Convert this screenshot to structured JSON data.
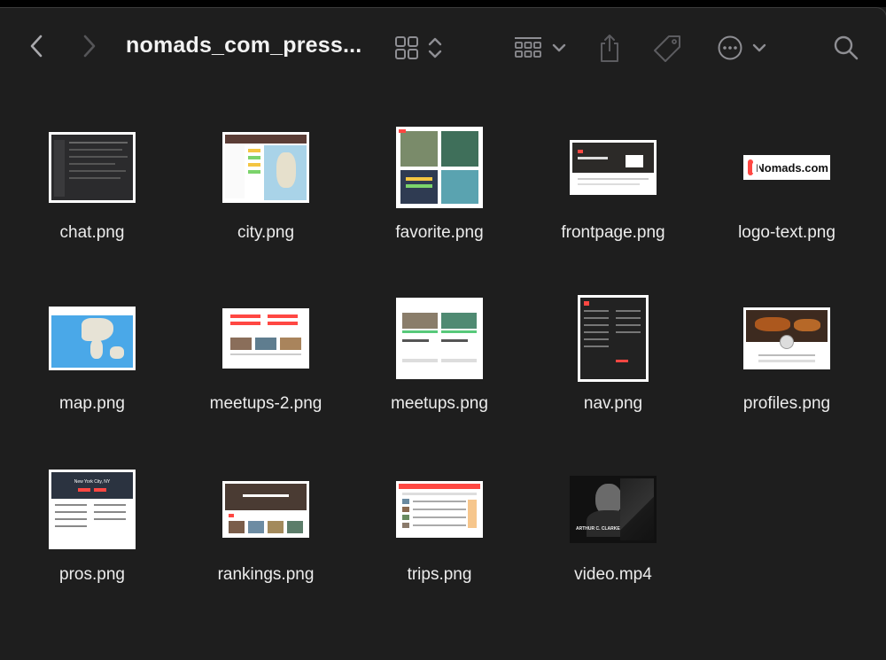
{
  "toolbar": {
    "title": "nomads_com_press...",
    "icons": [
      "back-icon",
      "forward-icon",
      "icon-view-icon",
      "sort-icon",
      "group-icon",
      "share-icon",
      "tag-icon",
      "more-icon",
      "search-icon"
    ]
  },
  "files": [
    {
      "name": "chat.png",
      "thumb": "dark-app"
    },
    {
      "name": "city.png",
      "thumb": "map-list"
    },
    {
      "name": "favorite.png",
      "thumb": "photo-grid"
    },
    {
      "name": "frontpage.png",
      "thumb": "landing"
    },
    {
      "name": "logo-text.png",
      "thumb": "logo",
      "logo_text": "Nomads.com"
    },
    {
      "name": "map.png",
      "thumb": "map"
    },
    {
      "name": "meetups-2.png",
      "thumb": "meetups-2"
    },
    {
      "name": "meetups.png",
      "thumb": "meetups"
    },
    {
      "name": "nav.png",
      "thumb": "nav"
    },
    {
      "name": "profiles.png",
      "thumb": "profiles"
    },
    {
      "name": "pros.png",
      "thumb": "pros",
      "caption": "New York City, NY"
    },
    {
      "name": "rankings.png",
      "thumb": "rankings"
    },
    {
      "name": "trips.png",
      "thumb": "trips"
    },
    {
      "name": "video.mp4",
      "thumb": "video",
      "caption": "ARTHUR C. CLARKE"
    }
  ],
  "colors": {
    "background": "#1e1e1e",
    "icon": "#8e8e93",
    "accent": "#ff4742"
  }
}
